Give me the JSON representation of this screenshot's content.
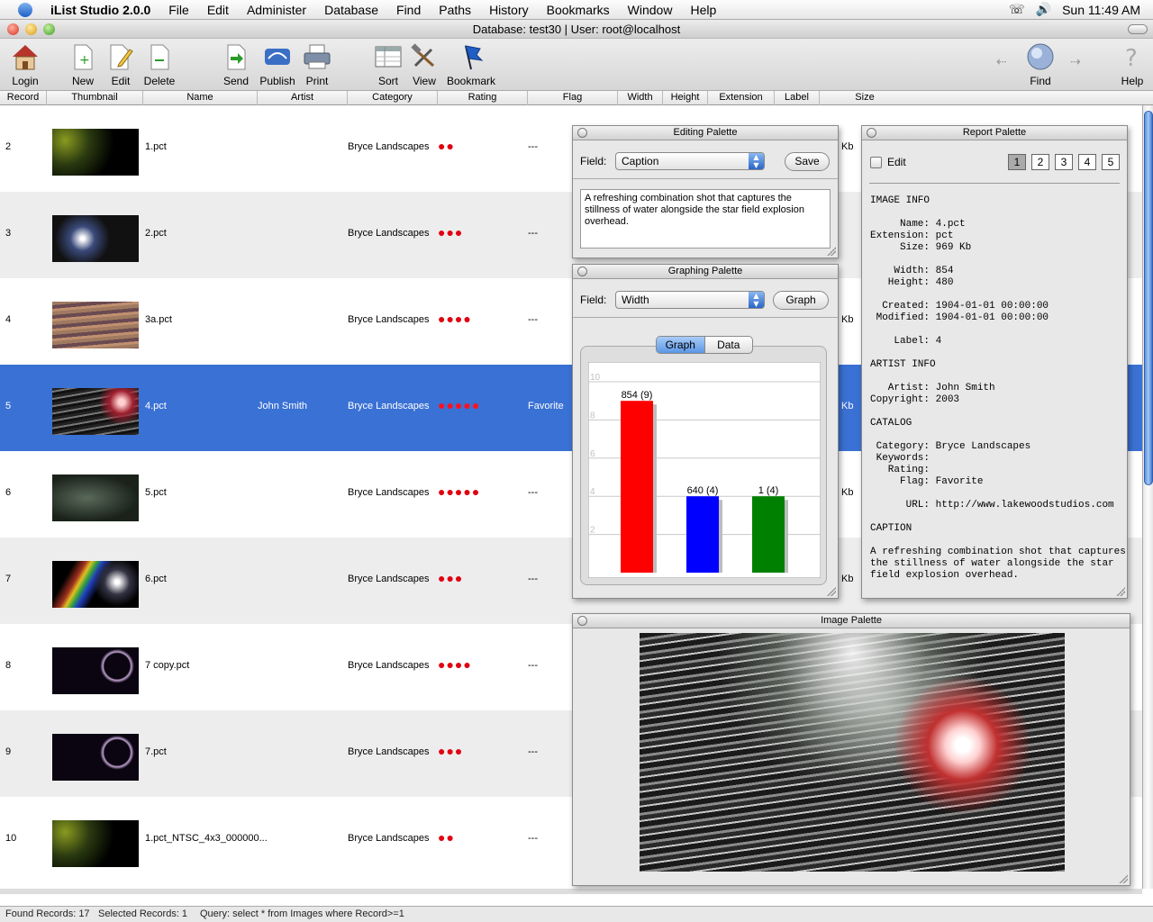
{
  "menubar": {
    "app": "iList Studio 2.0.0",
    "items": [
      "File",
      "Edit",
      "Administer",
      "Database",
      "Find",
      "Paths",
      "History",
      "Bookmarks",
      "Window",
      "Help"
    ],
    "clock": "Sun 11:49 AM"
  },
  "window": {
    "title": "Database: test30 | User: root@localhost"
  },
  "toolbar": {
    "login": "Login",
    "new": "New",
    "edit": "Edit",
    "delete": "Delete",
    "send": "Send",
    "publish": "Publish",
    "print": "Print",
    "sort": "Sort",
    "view": "View",
    "bookmark": "Bookmark",
    "find": "Find",
    "help": "Help"
  },
  "columns": [
    "Record",
    "Thumbnail",
    "Name",
    "Artist",
    "Category",
    "Rating",
    "Flag",
    "Width",
    "Height",
    "Extension",
    "Label",
    "Size"
  ],
  "rows": [
    {
      "record": "2",
      "name": "1.pct",
      "artist": "",
      "category": "Bryce Landscapes",
      "rating": 2,
      "flag": "---",
      "size": "Kb"
    },
    {
      "record": "3",
      "name": "2.pct",
      "artist": "",
      "category": "Bryce Landscapes",
      "rating": 3,
      "flag": "---",
      "size": ""
    },
    {
      "record": "4",
      "name": "3a.pct",
      "artist": "",
      "category": "Bryce Landscapes",
      "rating": 4,
      "flag": "---",
      "size": "Kb"
    },
    {
      "record": "5",
      "name": "4.pct",
      "artist": "John Smith",
      "category": "Bryce Landscapes",
      "rating": 5,
      "flag": "Favorite",
      "size": "Kb"
    },
    {
      "record": "6",
      "name": "5.pct",
      "artist": "",
      "category": "Bryce Landscapes",
      "rating": 5,
      "flag": "---",
      "size": "Kb"
    },
    {
      "record": "7",
      "name": "6.pct",
      "artist": "",
      "category": "Bryce Landscapes",
      "rating": 3,
      "flag": "---",
      "size": "Kb"
    },
    {
      "record": "8",
      "name": "7 copy.pct",
      "artist": "",
      "category": "Bryce Landscapes",
      "rating": 4,
      "flag": "---",
      "size": ""
    },
    {
      "record": "9",
      "name": "7.pct",
      "artist": "",
      "category": "Bryce Landscapes",
      "rating": 3,
      "flag": "---",
      "size": ""
    },
    {
      "record": "10",
      "name": "1.pct_NTSC_4x3_000000...",
      "artist": "",
      "category": "Bryce Landscapes",
      "rating": 2,
      "flag": "---",
      "size": ""
    }
  ],
  "editing_palette": {
    "title": "Editing Palette",
    "field_label": "Field:",
    "field_value": "Caption",
    "save": "Save",
    "text": "A refreshing combination shot that captures the stillness of water alongside the star field explosion overhead."
  },
  "graphing_palette": {
    "title": "Graphing Palette",
    "field_label": "Field:",
    "field_value": "Width",
    "graph_button": "Graph",
    "tab_graph": "Graph",
    "tab_data": "Data"
  },
  "chart_data": {
    "type": "bar",
    "title": "",
    "xlabel": "",
    "ylabel": "",
    "ylim": [
      0,
      10
    ],
    "yticks": [
      "2",
      "4",
      "6",
      "8",
      "10"
    ],
    "values": [
      9,
      4,
      4
    ],
    "labels": [
      "854 (9)",
      "640 (4)",
      "1 (4)"
    ],
    "colors": [
      "#ff0000",
      "#0000ff",
      "#008000"
    ]
  },
  "report_palette": {
    "title": "Report Palette",
    "edit": "Edit",
    "pages": [
      "1",
      "2",
      "3",
      "4",
      "5"
    ],
    "image_info": "IMAGE INFO",
    "name_line": "     Name: 4.pct",
    "ext_line": "Extension: pct",
    "size_line": "     Size: 969 Kb",
    "width_line": "    Width: 854",
    "height_line": "   Height: 480",
    "created_line": "  Created: 1904-01-01 00:00:00",
    "modified_line": " Modified: 1904-01-01 00:00:00",
    "label_line": "    Label: 4",
    "artist_info": "ARTIST INFO",
    "artist_line": "   Artist: John Smith",
    "copyright_line": "Copyright: 2003",
    "catalog": "CATALOG",
    "category_line": " Category: Bryce Landscapes",
    "keywords_line": " Keywords:",
    "rating_line": "   Rating:",
    "flag_line": "     Flag: Favorite",
    "url_line": "      URL: http://www.lakewoodstudios.com",
    "caption": "CAPTION",
    "caption_1": "A refreshing combination shot that captures",
    "caption_2": "the stillness of water alongside the star",
    "caption_3": "field explosion overhead."
  },
  "image_palette": {
    "title": "Image Palette"
  },
  "status": {
    "found": "Found Records: 17",
    "selected": "Selected Records: 1",
    "query": "Query: select * from Images where Record>=1"
  },
  "colors": {
    "selection": "#3a71d4",
    "rating_dot": "#e00010",
    "accent": "#2a65c8"
  }
}
